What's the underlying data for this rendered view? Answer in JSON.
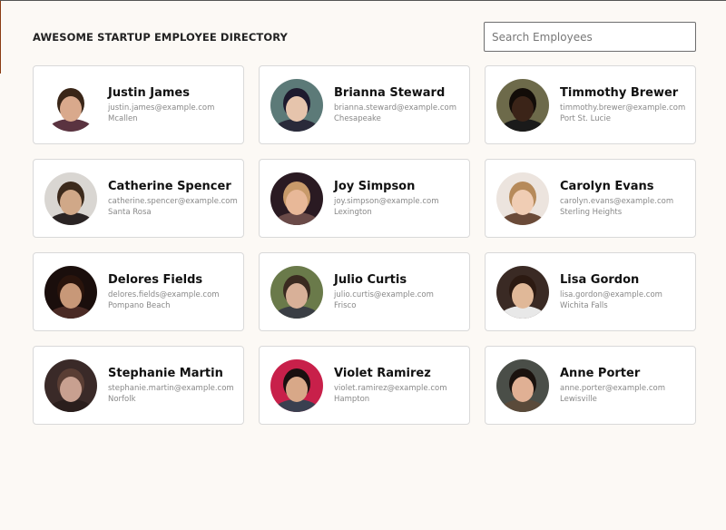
{
  "header": {
    "title": "AWESOME STARTUP EMPLOYEE DIRECTORY",
    "search_placeholder": "Search Employees",
    "search_value": ""
  },
  "employees": [
    {
      "name": "Justin James",
      "email": "justin.james@example.com",
      "city": "Mcallen",
      "avatar": {
        "bg": "#ffffff",
        "skin": "#d9a98c",
        "hair": "#3a2618",
        "shirt": "#5a3340"
      }
    },
    {
      "name": "Brianna Steward",
      "email": "brianna.steward@example.com",
      "city": "Chesapeake",
      "avatar": {
        "bg": "#5c7a78",
        "skin": "#e6c4ac",
        "hair": "#1e1a2e",
        "shirt": "#2a2a3a"
      }
    },
    {
      "name": "Timmothy Brewer",
      "email": "timmothy.brewer@example.com",
      "city": "Port St. Lucie",
      "avatar": {
        "bg": "#6d6a4a",
        "skin": "#3b2418",
        "hair": "#120c08",
        "shirt": "#1a1a1a"
      }
    },
    {
      "name": "Catherine Spencer",
      "email": "catherine.spencer@example.com",
      "city": "Santa Rosa",
      "avatar": {
        "bg": "#d9d6d2",
        "skin": "#d0a888",
        "hair": "#3c2a1c",
        "shirt": "#2a2424"
      }
    },
    {
      "name": "Joy Simpson",
      "email": "joy.simpson@example.com",
      "city": "Lexington",
      "avatar": {
        "bg": "#2a1a22",
        "skin": "#e8b898",
        "hair": "#c89a6a",
        "shirt": "#6a4a48"
      }
    },
    {
      "name": "Carolyn Evans",
      "email": "carolyn.evans@example.com",
      "city": "Sterling Heights",
      "avatar": {
        "bg": "#ece4de",
        "skin": "#f0cdb4",
        "hair": "#b68a5a",
        "shirt": "#6a4a38"
      }
    },
    {
      "name": "Delores Fields",
      "email": "delores.fields@example.com",
      "city": "Pompano Beach",
      "avatar": {
        "bg": "#1a0e0c",
        "skin": "#c89878",
        "hair": "#2a140c",
        "shirt": "#4a2a24"
      }
    },
    {
      "name": "Julio Curtis",
      "email": "julio.curtis@example.com",
      "city": "Frisco",
      "avatar": {
        "bg": "#6a7a4a",
        "skin": "#d8b098",
        "hair": "#3a2a20",
        "shirt": "#3a3e44"
      }
    },
    {
      "name": "Lisa Gordon",
      "email": "lisa.gordon@example.com",
      "city": "Wichita Falls",
      "avatar": {
        "bg": "#3a2a24",
        "skin": "#e0b898",
        "hair": "#2c1a12",
        "shirt": "#e8e8e8"
      }
    },
    {
      "name": "Stephanie Martin",
      "email": "stephanie.martin@example.com",
      "city": "Norfolk",
      "avatar": {
        "bg": "#3a2a28",
        "skin": "#c8a090",
        "hair": "#5a3e34",
        "shirt": "#2a1e1c"
      }
    },
    {
      "name": "Violet Ramirez",
      "email": "violet.ramirez@example.com",
      "city": "Hampton",
      "avatar": {
        "bg": "#c8204a",
        "skin": "#d8a888",
        "hair": "#1a1010",
        "shirt": "#3a4050"
      }
    },
    {
      "name": "Anne Porter",
      "email": "anne.porter@example.com",
      "city": "Lewisville",
      "avatar": {
        "bg": "#4a4e48",
        "skin": "#e0b094",
        "hair": "#1a120e",
        "shirt": "#5a4a3a"
      }
    }
  ]
}
